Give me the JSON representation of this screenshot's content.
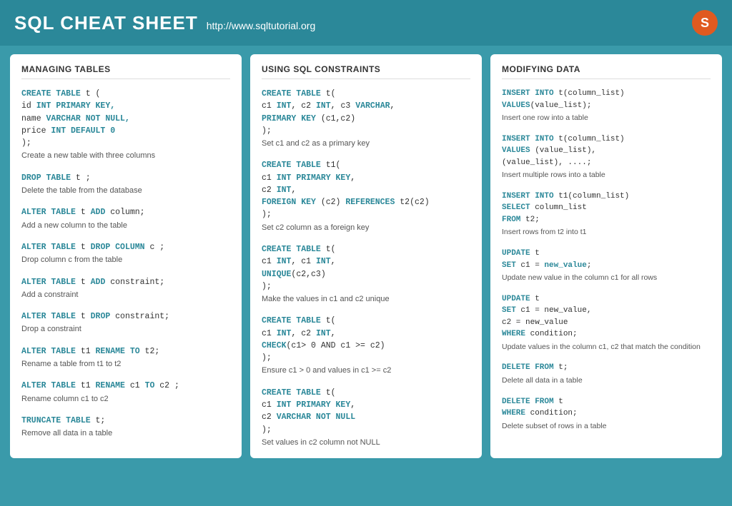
{
  "header": {
    "title": "SQL CHEAT SHEET",
    "url": "http://www.sqltutorial.org",
    "logo": "S"
  },
  "managing_tables": {
    "title": "MANAGING TABLES",
    "sections": [
      {
        "id": "create-table",
        "lines": [
          {
            "text": "CREATE TABLE t (",
            "parts": [
              {
                "t": "CREATE TABLE",
                "cls": "kw"
              },
              {
                "t": " t (",
                "cls": "normal"
              }
            ]
          },
          {
            "text": "    id INT PRIMARY KEY,",
            "parts": [
              {
                "t": "    id ",
                "cls": "normal"
              },
              {
                "t": "INT PRIMARY KEY,",
                "cls": "kw"
              }
            ]
          },
          {
            "text": "    name VARCHAR NOT NULL,",
            "parts": [
              {
                "t": "    name ",
                "cls": "normal"
              },
              {
                "t": "VARCHAR NOT NULL,",
                "cls": "kw"
              }
            ]
          },
          {
            "text": "    price INT DEFAULT 0",
            "parts": [
              {
                "t": "    price ",
                "cls": "normal"
              },
              {
                "t": "INT DEFAULT 0",
                "cls": "kw"
              }
            ]
          },
          {
            "text": ");",
            "parts": [
              {
                "t": ");",
                "cls": "normal"
              }
            ]
          }
        ],
        "desc": "Create a new table with three columns"
      },
      {
        "id": "drop-table",
        "lines": [
          {
            "parts": [
              {
                "t": "DROP TABLE",
                "cls": "kw"
              },
              {
                "t": " t ",
                "cls": "normal"
              },
              {
                "t": ";",
                "cls": "normal"
              }
            ]
          }
        ],
        "desc": "Delete the table from the database"
      },
      {
        "id": "alter-add-column",
        "lines": [
          {
            "parts": [
              {
                "t": "ALTER TABLE",
                "cls": "kw"
              },
              {
                "t": " t ",
                "cls": "normal"
              },
              {
                "t": "ADD",
                "cls": "kw"
              },
              {
                "t": " column;",
                "cls": "normal"
              }
            ]
          }
        ],
        "desc": "Add a new column to the table"
      },
      {
        "id": "alter-drop-column",
        "lines": [
          {
            "parts": [
              {
                "t": "ALTER TABLE",
                "cls": "kw"
              },
              {
                "t": " t ",
                "cls": "normal"
              },
              {
                "t": "DROP COLUMN",
                "cls": "kw"
              },
              {
                "t": " c ;",
                "cls": "normal"
              }
            ]
          }
        ],
        "desc": "Drop column c from the table"
      },
      {
        "id": "alter-add-constraint",
        "lines": [
          {
            "parts": [
              {
                "t": "ALTER TABLE",
                "cls": "kw"
              },
              {
                "t": " t ",
                "cls": "normal"
              },
              {
                "t": "ADD",
                "cls": "kw"
              },
              {
                "t": " constraint;",
                "cls": "normal"
              }
            ]
          }
        ],
        "desc": "Add a constraint"
      },
      {
        "id": "alter-drop-constraint",
        "lines": [
          {
            "parts": [
              {
                "t": "ALTER TABLE",
                "cls": "kw"
              },
              {
                "t": " t ",
                "cls": "normal"
              },
              {
                "t": "DROP",
                "cls": "kw"
              },
              {
                "t": " constraint;",
                "cls": "normal"
              }
            ]
          }
        ],
        "desc": "Drop a constraint"
      },
      {
        "id": "alter-rename-table",
        "lines": [
          {
            "parts": [
              {
                "t": "ALTER TABLE",
                "cls": "kw"
              },
              {
                "t": " t1 ",
                "cls": "normal"
              },
              {
                "t": "RENAME TO",
                "cls": "kw"
              },
              {
                "t": " t2;",
                "cls": "normal"
              }
            ]
          }
        ],
        "desc": "Rename a table from t1 to t2"
      },
      {
        "id": "alter-rename-column",
        "lines": [
          {
            "parts": [
              {
                "t": "ALTER TABLE",
                "cls": "kw"
              },
              {
                "t": " t1 ",
                "cls": "normal"
              },
              {
                "t": "RENAME",
                "cls": "kw"
              },
              {
                "t": " c1 ",
                "cls": "normal"
              },
              {
                "t": "TO",
                "cls": "kw"
              },
              {
                "t": " c2 ;",
                "cls": "normal"
              }
            ]
          }
        ],
        "desc": "Rename column c1 to c2"
      },
      {
        "id": "truncate",
        "lines": [
          {
            "parts": [
              {
                "t": "TRUNCATE TABLE",
                "cls": "kw"
              },
              {
                "t": " t;",
                "cls": "normal"
              }
            ]
          }
        ],
        "desc": "Remove all data in a table"
      }
    ]
  },
  "sql_constraints": {
    "title": "USING SQL CONSTRAINTS",
    "sections": [
      {
        "id": "create-primary-key",
        "lines": [
          {
            "parts": [
              {
                "t": "CREATE TABLE",
                "cls": "kw"
              },
              {
                "t": " t(",
                "cls": "normal"
              }
            ]
          },
          {
            "parts": [
              {
                "t": "  c1 ",
                "cls": "normal"
              },
              {
                "t": "INT",
                "cls": "kw"
              },
              {
                "t": ", c2 ",
                "cls": "normal"
              },
              {
                "t": "INT",
                "cls": "kw"
              },
              {
                "t": ", c3 ",
                "cls": "normal"
              },
              {
                "t": "VARCHAR",
                "cls": "kw"
              },
              {
                "t": ",",
                "cls": "normal"
              }
            ]
          },
          {
            "parts": [
              {
                "t": "  PRIMARY KEY",
                "cls": "kw"
              },
              {
                "t": " (c1,c2)",
                "cls": "normal"
              }
            ]
          },
          {
            "parts": [
              {
                "t": ");",
                "cls": "normal"
              }
            ]
          }
        ],
        "desc": "Set c1 and c2 as a primary key"
      },
      {
        "id": "create-foreign-key",
        "lines": [
          {
            "parts": [
              {
                "t": "CREATE TABLE",
                "cls": "kw"
              },
              {
                "t": " t1(",
                "cls": "normal"
              }
            ]
          },
          {
            "parts": [
              {
                "t": "  c1 ",
                "cls": "normal"
              },
              {
                "t": "INT PRIMARY KEY",
                "cls": "kw"
              },
              {
                "t": ",",
                "cls": "normal"
              }
            ]
          },
          {
            "parts": [
              {
                "t": "  c2 ",
                "cls": "normal"
              },
              {
                "t": "INT",
                "cls": "kw"
              },
              {
                "t": ",",
                "cls": "normal"
              }
            ]
          },
          {
            "parts": [
              {
                "t": "  FOREIGN KEY",
                "cls": "kw"
              },
              {
                "t": " (c2) ",
                "cls": "normal"
              },
              {
                "t": "REFERENCES",
                "cls": "kw"
              },
              {
                "t": " t2(c2)",
                "cls": "normal"
              }
            ]
          },
          {
            "parts": [
              {
                "t": ");",
                "cls": "normal"
              }
            ]
          }
        ],
        "desc": "Set c2 column as a foreign key"
      },
      {
        "id": "create-unique",
        "lines": [
          {
            "parts": [
              {
                "t": "CREATE TABLE",
                "cls": "kw"
              },
              {
                "t": " t(",
                "cls": "normal"
              }
            ]
          },
          {
            "parts": [
              {
                "t": "  c1 ",
                "cls": "normal"
              },
              {
                "t": "INT",
                "cls": "kw"
              },
              {
                "t": ", c1 ",
                "cls": "normal"
              },
              {
                "t": "INT",
                "cls": "kw"
              },
              {
                "t": ",",
                "cls": "normal"
              }
            ]
          },
          {
            "parts": [
              {
                "t": "  UNIQUE",
                "cls": "kw"
              },
              {
                "t": "(c2,c3)",
                "cls": "normal"
              }
            ]
          },
          {
            "parts": [
              {
                "t": ");",
                "cls": "normal"
              }
            ]
          }
        ],
        "desc": "Make the values in c1 and c2 unique"
      },
      {
        "id": "create-check",
        "lines": [
          {
            "parts": [
              {
                "t": "CREATE TABLE",
                "cls": "kw"
              },
              {
                "t": " t(",
                "cls": "normal"
              }
            ]
          },
          {
            "parts": [
              {
                "t": "  c1 ",
                "cls": "normal"
              },
              {
                "t": "INT",
                "cls": "kw"
              },
              {
                "t": ", c2 ",
                "cls": "normal"
              },
              {
                "t": "INT",
                "cls": "kw"
              },
              {
                "t": ",",
                "cls": "normal"
              }
            ]
          },
          {
            "parts": [
              {
                "t": "  CHECK",
                "cls": "kw"
              },
              {
                "t": "(c1> 0 AND c1 >= c2)",
                "cls": "normal"
              }
            ]
          },
          {
            "parts": [
              {
                "t": ");",
                "cls": "normal"
              }
            ]
          }
        ],
        "desc": "Ensure c1 > 0 and values in c1 >= c2"
      },
      {
        "id": "create-not-null",
        "lines": [
          {
            "parts": [
              {
                "t": "CREATE TABLE",
                "cls": "kw"
              },
              {
                "t": " t(",
                "cls": "normal"
              }
            ]
          },
          {
            "parts": [
              {
                "t": "  c1 ",
                "cls": "normal"
              },
              {
                "t": "INT PRIMARY KEY",
                "cls": "kw"
              },
              {
                "t": ",",
                "cls": "normal"
              }
            ]
          },
          {
            "parts": [
              {
                "t": "  c2 ",
                "cls": "normal"
              },
              {
                "t": "VARCHAR NOT NULL",
                "cls": "kw"
              }
            ]
          },
          {
            "parts": [
              {
                "t": ");",
                "cls": "normal"
              }
            ]
          }
        ],
        "desc": "Set values in c2 column not NULL"
      }
    ]
  },
  "modifying_data": {
    "title": "MODIFYING DATA",
    "sections": [
      {
        "id": "insert-one",
        "lines": [
          {
            "parts": [
              {
                "t": "INSERT INTO",
                "cls": "kw"
              },
              {
                "t": " t(column_list)",
                "cls": "normal"
              }
            ]
          },
          {
            "parts": [
              {
                "t": "VALUES",
                "cls": "kw"
              },
              {
                "t": "(value_list);",
                "cls": "normal"
              }
            ]
          }
        ],
        "desc": "Insert one row into a table"
      },
      {
        "id": "insert-multiple",
        "lines": [
          {
            "parts": [
              {
                "t": "INSERT INTO",
                "cls": "kw"
              },
              {
                "t": " t(column_list)",
                "cls": "normal"
              }
            ]
          },
          {
            "parts": [
              {
                "t": "VALUES",
                "cls": "kw"
              },
              {
                "t": " (value_list),",
                "cls": "normal"
              }
            ]
          },
          {
            "parts": [
              {
                "t": "        ",
                "cls": "normal"
              },
              {
                "t": "(value_list), ....;",
                "cls": "normal"
              }
            ]
          }
        ],
        "desc": "Insert multiple rows into a table"
      },
      {
        "id": "insert-from",
        "lines": [
          {
            "parts": [
              {
                "t": "INSERT INTO",
                "cls": "kw"
              },
              {
                "t": " t1(column_list)",
                "cls": "normal"
              }
            ]
          },
          {
            "parts": [
              {
                "t": "SELECT",
                "cls": "kw"
              },
              {
                "t": " column_list",
                "cls": "normal"
              }
            ]
          },
          {
            "parts": [
              {
                "t": "FROM",
                "cls": "kw"
              },
              {
                "t": " t2;",
                "cls": "normal"
              }
            ]
          }
        ],
        "desc": "Insert rows from t2 into t1"
      },
      {
        "id": "update-all",
        "lines": [
          {
            "parts": [
              {
                "t": "UPDATE",
                "cls": "kw"
              },
              {
                "t": " t",
                "cls": "normal"
              }
            ]
          },
          {
            "parts": [
              {
                "t": "SET",
                "cls": "kw"
              },
              {
                "t": " c1 = ",
                "cls": "normal"
              },
              {
                "t": "new_value",
                "cls": "kw"
              },
              {
                "t": ";",
                "cls": "normal"
              }
            ]
          }
        ],
        "desc": "Update new value in the column c1 for all rows"
      },
      {
        "id": "update-where",
        "lines": [
          {
            "parts": [
              {
                "t": "UPDATE",
                "cls": "kw"
              },
              {
                "t": " t",
                "cls": "normal"
              }
            ]
          },
          {
            "parts": [
              {
                "t": "SET",
                "cls": "kw"
              },
              {
                "t": " c1 = new_value,",
                "cls": "normal"
              }
            ]
          },
          {
            "parts": [
              {
                "t": "    c2 = new_value",
                "cls": "normal"
              }
            ]
          },
          {
            "parts": [
              {
                "t": "WHERE",
                "cls": "kw"
              },
              {
                "t": " condition;",
                "cls": "normal"
              }
            ]
          }
        ],
        "desc": "Update values in the column c1, c2 that match the condition"
      },
      {
        "id": "delete-all",
        "lines": [
          {
            "parts": [
              {
                "t": "DELETE FROM",
                "cls": "kw"
              },
              {
                "t": " t;",
                "cls": "normal"
              }
            ]
          }
        ],
        "desc": "Delete all data in a table"
      },
      {
        "id": "delete-where",
        "lines": [
          {
            "parts": [
              {
                "t": "DELETE FROM",
                "cls": "kw"
              },
              {
                "t": " t",
                "cls": "normal"
              }
            ]
          },
          {
            "parts": [
              {
                "t": "WHERE",
                "cls": "kw"
              },
              {
                "t": " condition;",
                "cls": "normal"
              }
            ]
          }
        ],
        "desc": "Delete subset of rows in a table"
      }
    ]
  }
}
